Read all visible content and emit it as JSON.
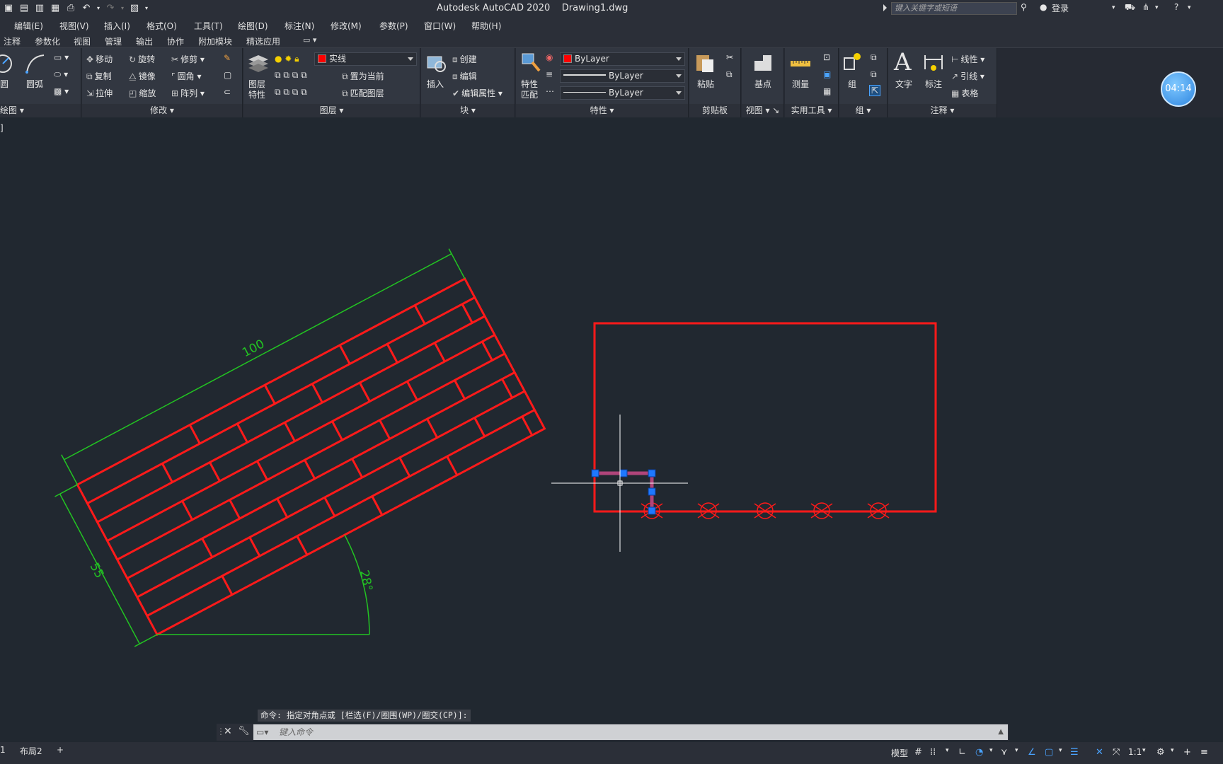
{
  "title_bar": {
    "app_title": "Autodesk AutoCAD 2020    Drawing1.dwg",
    "search_placeholder": "键入关键字或短语",
    "login_label": "登录"
  },
  "menu": [
    "编辑(E)",
    "视图(V)",
    "插入(I)",
    "格式(O)",
    "工具(T)",
    "绘图(D)",
    "标注(N)",
    "修改(M)",
    "参数(P)",
    "窗口(W)",
    "帮助(H)"
  ],
  "tabs": [
    "注释",
    "参数化",
    "视图",
    "管理",
    "输出",
    "协作",
    "附加模块",
    "精选应用"
  ],
  "ribbon": {
    "draw_panel": {
      "circle": "圆",
      "arc": "圆弧",
      "title": "绘图"
    },
    "modify_panel": {
      "move": "移动",
      "rotate": "旋转",
      "trim": "修剪",
      "copy": "复制",
      "mirror": "镜像",
      "fillet": "圆角",
      "stretch": "拉伸",
      "scale": "缩放",
      "array": "阵列",
      "title": "修改"
    },
    "layers_panel": {
      "layer_props_line1": "图层",
      "layer_props_line2": "特性",
      "current_layer": "实线",
      "set_current": "置为当前",
      "match_layer": "匹配图层",
      "title": "图层"
    },
    "block_panel": {
      "insert": "插入",
      "create": "创建",
      "edit": "编辑",
      "edit_attr": "编辑属性",
      "title": "块"
    },
    "properties_panel": {
      "match_line1": "特性",
      "match_line2": "匹配",
      "color": "ByLayer",
      "linetype": "ByLayer",
      "lineweight": "ByLayer",
      "title": "特性"
    },
    "clipboard_panel": {
      "paste": "粘贴",
      "title": "剪贴板"
    },
    "view_panel": {
      "base": "基点",
      "title": "视图"
    },
    "utilities_panel": {
      "measure": "测量",
      "title": "实用工具"
    },
    "groups_panel": {
      "group": "组",
      "title": "组"
    },
    "annotation_panel": {
      "text": "文字",
      "dimension": "标注",
      "linear": "线性",
      "leader": "引线",
      "table": "表格",
      "title": "注释"
    }
  },
  "timer": "04:14",
  "view_label": "]",
  "drawing": {
    "dim_length": "100",
    "dim_width": "55",
    "dim_angle": "28°",
    "colors": {
      "geometry": "#ff1a1a",
      "dimension": "#22c422",
      "crosshair": "#ffffff",
      "grip": "#1e78ff"
    }
  },
  "command": {
    "history": "命令: 指定对角点或 [栏选(F)/圈围(WP)/圈交(CP)]:",
    "placeholder": "键入命令"
  },
  "status": {
    "layout_tabs": [
      "1",
      "布局2"
    ],
    "model_label": "模型",
    "scale_label": "1:1"
  }
}
